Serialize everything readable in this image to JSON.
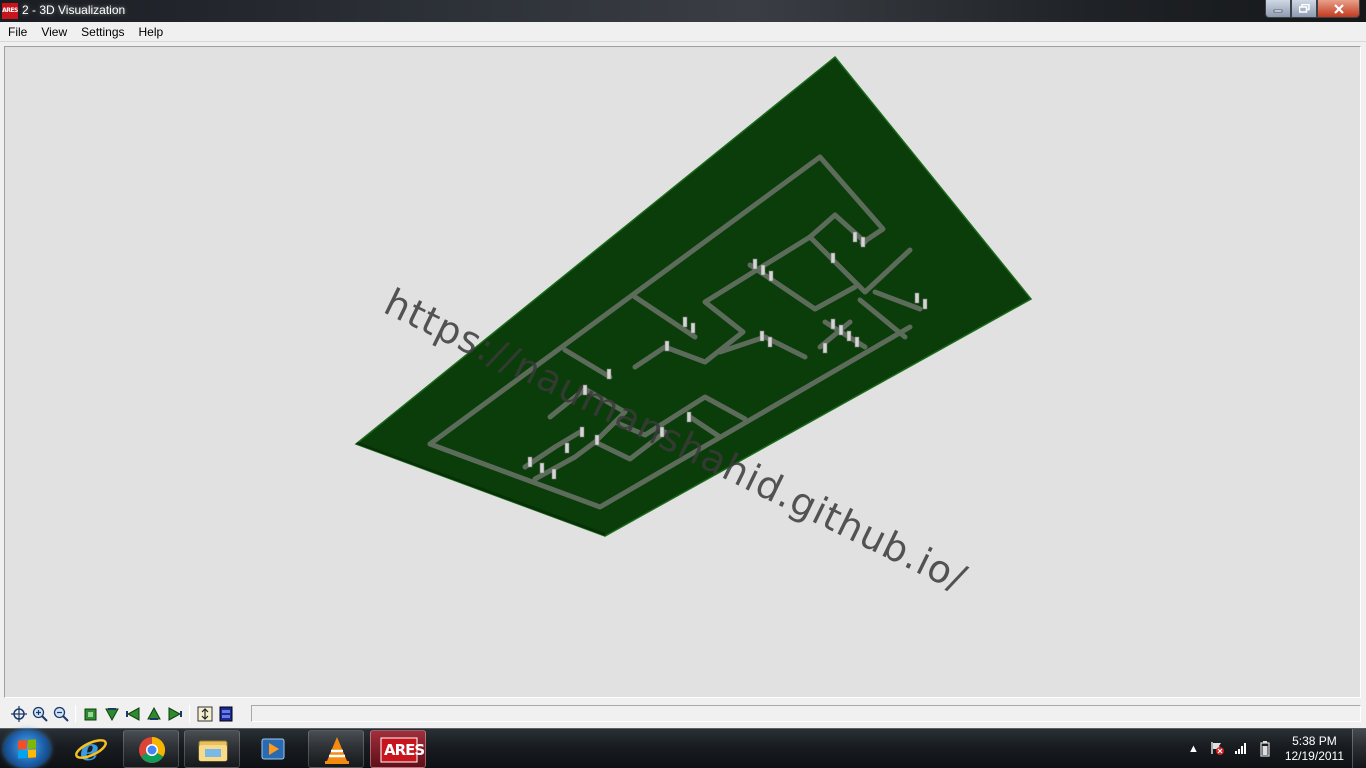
{
  "window": {
    "title": "2 - 3D Visualization",
    "app_icon_text": "ARES",
    "controls": {
      "minimize": "min-icon",
      "maximize": "max-icon",
      "close": "close-icon"
    }
  },
  "menu": {
    "items": [
      {
        "label": "File"
      },
      {
        "label": "View"
      },
      {
        "label": "Settings"
      },
      {
        "label": "Help"
      }
    ]
  },
  "viewport": {
    "background": "#e1e1e1",
    "board_color": "#0a3d0a",
    "trace_color": "#5a6b5a",
    "pad_color": "#d8d8d8",
    "watermark": "https://naumanshahid.github.io/"
  },
  "toolbar": {
    "buttons": [
      {
        "icon": "pan-crosshair-icon"
      },
      {
        "icon": "zoom-in-icon"
      },
      {
        "icon": "zoom-out-icon"
      },
      {
        "icon": "view-top-icon"
      },
      {
        "icon": "view-front-icon"
      },
      {
        "icon": "view-left-icon"
      },
      {
        "icon": "view-back-icon"
      },
      {
        "icon": "view-right-icon"
      },
      {
        "icon": "height-toggle-icon"
      },
      {
        "icon": "layer-toggle-icon"
      }
    ]
  },
  "taskbar": {
    "items": [
      {
        "icon": "internet-explorer-icon"
      },
      {
        "icon": "chrome-icon"
      },
      {
        "icon": "file-explorer-icon"
      },
      {
        "icon": "media-player-icon"
      },
      {
        "icon": "vlc-icon"
      },
      {
        "icon": "ares-icon",
        "label": "ARES"
      }
    ],
    "clock_time": "5:38 PM",
    "clock_date": "12/19/2011",
    "tray": [
      "show-hidden-icon",
      "action-center-flag-icon",
      "network-signal-icon",
      "battery-icon"
    ]
  }
}
